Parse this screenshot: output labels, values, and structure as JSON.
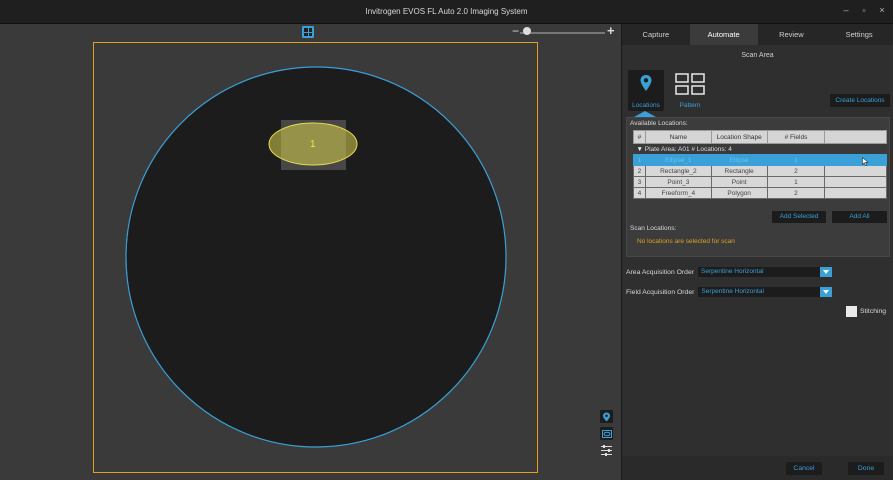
{
  "window": {
    "title": "Invitrogen EVOS FL Auto 2.0 Imaging System"
  },
  "window_controls": {
    "minimize": "–",
    "restore": "▫",
    "close": "×"
  },
  "viewer": {
    "zoom_minus": "−",
    "zoom_plus": "+",
    "zoom_level": 0.05,
    "well_location_label": "1"
  },
  "tabs": [
    "Capture",
    "Automate",
    "Review",
    "Settings"
  ],
  "active_tab": "Automate",
  "scan_area": {
    "title": "Scan Area",
    "mode_locations": "Locations",
    "mode_pattern": "Pattern",
    "create_locations": "Create Locations",
    "available_caption": "Available Locations:",
    "table": {
      "headers": [
        "#",
        "Name",
        "Location Shape",
        "# Fields",
        ""
      ],
      "group_row": "Plate  Area: A01    # Locations: 4",
      "rows": [
        [
          "1",
          "Ellipse_1",
          "Ellipse",
          "1"
        ],
        [
          "2",
          "Rectangle_2",
          "Rectangle",
          "2"
        ],
        [
          "3",
          "Point_3",
          "Point",
          "1"
        ],
        [
          "4",
          "Freeform_4",
          "Polygon",
          "2"
        ]
      ]
    },
    "add_selected": "Add Selected",
    "add_all": "Add All",
    "scan_locations_caption": "Scan Locations:",
    "scan_locations_empty": "No locations are selected for scan"
  },
  "area_order": {
    "label": "Area Acquisition Order",
    "value": "Serpentine Horizontal"
  },
  "field_order": {
    "label": "Field Acquisition Order",
    "value": "Serpentine Horizontal"
  },
  "stitching": {
    "label": "Stitching"
  },
  "footer": {
    "cancel": "Cancel",
    "done": "Done"
  },
  "colors": {
    "accent": "#3aa0d8",
    "plate_border": "#e0a020",
    "well_outline": "#3aa0d8",
    "roi_fill": "#d8cf4a"
  }
}
